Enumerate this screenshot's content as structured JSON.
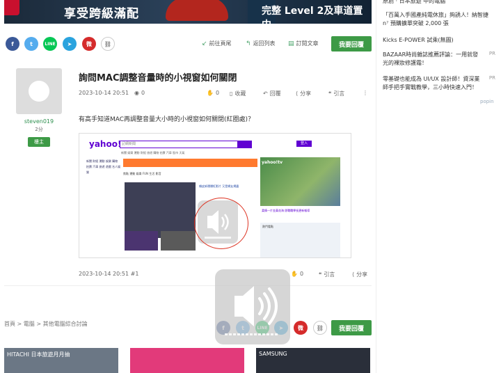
{
  "banner": {
    "text_left": "享受跨級滿配",
    "text_right": "完整 Level 2及車道置中"
  },
  "sidebar": {
    "items": [
      {
        "text": "原創 · 日本旅遊 中的電腦",
        "pr": ""
      },
      {
        "text": "「百萬入手國產純電休旅」夠誘人！納智捷 n⁷ 預購擴單突破 2,000 張",
        "pr": ""
      },
      {
        "text": "Kicks E-POWER 試乘(無圖)",
        "pr": ""
      },
      {
        "text": "BAZAAR時尚雜誌推薦評論：一用就發光的裸妝修護霜！",
        "pr": "PR"
      },
      {
        "text": "零基礎也能成為 UI/UX 設計師！資深業師手把手實戰教學，三小時快速入門！",
        "pr": "PR"
      }
    ],
    "popin": "popin"
  },
  "share": {
    "fb": "f",
    "tw": "t",
    "line": "LINE",
    "tg": "➤",
    "wb": "微",
    "lk": "⛓"
  },
  "toolbar": {
    "first": "前往頁尾",
    "back": "返回列表",
    "subscribe": "訂閱文章",
    "reply": "我要回覆"
  },
  "author": {
    "name": "steven019",
    "points": "2分",
    "badge": "樓主"
  },
  "post": {
    "title": "詢問MAC調整音量時的小視窗如何關閉",
    "date": "2023-10-14 20:51",
    "views": "0",
    "likes": "0",
    "collect": "收藏",
    "reply": "回覆",
    "share": "分享",
    "quote": "引言",
    "body": "有高手知道MAC再調整音量大小時的小視窗如何關閉(紅圈處)？",
    "foot_date": "2023-10-14 20:51 #1",
    "foot_likes": "0",
    "foot_quote": "引言",
    "foot_share": "分享"
  },
  "screenshot": {
    "logo": "yahoo!",
    "search_placeholder": "記網新聞",
    "login": "登入",
    "nav": "新聞 娛樂 運動 財經 旅遊 購物 拍賣 汽車 股市 天氣",
    "left_menu": "新聞 財經 運動 娛樂 購物 拍賣 汽車 旅遊 遊戲 名人娛樂",
    "tabs": "焦點  運動  娛樂  FUN  生活  影音",
    "headline": "賴皮卸運爆紅影片 又是網友揭露",
    "tv": "yahoo!tv",
    "side_line": "柔情一片金黃花海 即戰戰學長更新報導",
    "side_box": "熱門看點"
  },
  "breadcrumb": {
    "home": "首頁",
    "sep": ">",
    "cat": "電腦",
    "sub": "其他電腦綜合討論"
  },
  "ads": {
    "a1": "HITACHI 日本旅遊月月抽",
    "a3": "SAMSUNG"
  }
}
